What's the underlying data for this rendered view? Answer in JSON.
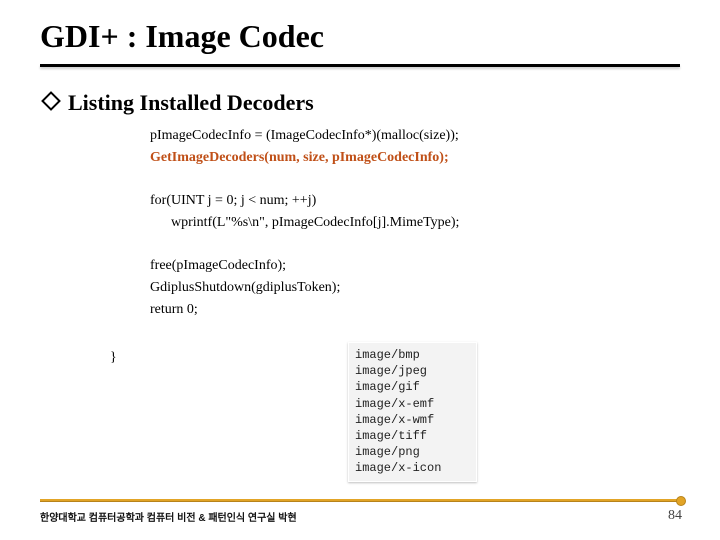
{
  "title": "GDI+ : Image Codec",
  "subheading": "Listing Installed Decoders",
  "code_line1": "pImageCodecInfo = (ImageCodecInfo*)(malloc(size));",
  "code_highlight": "GetImageDecoders(num, size, pImageCodecInfo);",
  "code_line3": "for(UINT j = 0; j < num; ++j)",
  "code_line4": "      wprintf(L\"%s\\n\", pImageCodecInfo[j].MimeType);",
  "code_line5": "free(pImageCodecInfo);",
  "code_line6": "GdiplusShutdown(gdiplusToken);",
  "code_line7": "return 0;",
  "brace": "}",
  "output": "image/bmp\nimage/jpeg\nimage/gif\nimage/x-emf\nimage/x-wmf\nimage/tiff\nimage/png\nimage/x-icon",
  "footer_left": "한양대학교 컴퓨터공학과   컴퓨터 비전 & 패턴인식 연구실    박현",
  "page_number": "84"
}
